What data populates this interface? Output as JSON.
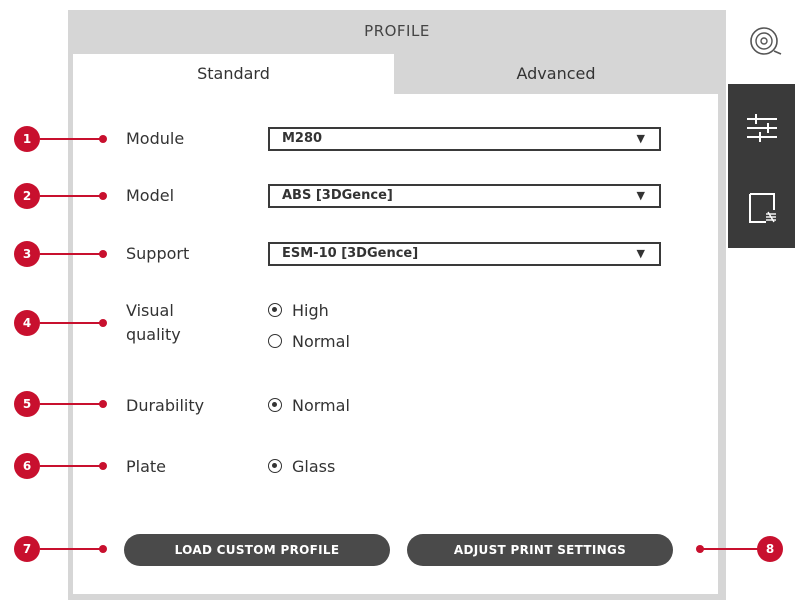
{
  "header": {
    "title": "PROFILE"
  },
  "tabs": [
    {
      "label": "Standard"
    },
    {
      "label": "Advanced"
    }
  ],
  "fields": {
    "module": {
      "label": "Module",
      "value": "M280"
    },
    "model": {
      "label": "Model",
      "value": "ABS [3DGence]"
    },
    "support": {
      "label": "Support",
      "value": "ESM-10 [3DGence]"
    },
    "visual_quality": {
      "label_line1": "Visual",
      "label_line2": "quality",
      "options": [
        {
          "label": "High",
          "checked": true
        },
        {
          "label": "Normal",
          "checked": false
        }
      ]
    },
    "durability": {
      "label": "Durability",
      "options": [
        {
          "label": "Normal",
          "checked": true
        }
      ]
    },
    "plate": {
      "label": "Plate",
      "options": [
        {
          "label": "Glass",
          "checked": true
        }
      ]
    }
  },
  "buttons": {
    "load": "LOAD CUSTOM PROFILE",
    "adjust": "ADJUST PRINT SETTINGS"
  },
  "callouts": [
    "1",
    "2",
    "3",
    "4",
    "5",
    "6",
    "7",
    "8"
  ],
  "icons": {
    "header": "disc-icon",
    "side_top": "sliders-icon",
    "side_bottom": "layer-icon",
    "dropdown": "▼"
  },
  "colors": {
    "accent": "#c8102e",
    "button": "#4a4a4a",
    "side_strip": "#3a3a3a",
    "panel": "#d6d6d6"
  }
}
